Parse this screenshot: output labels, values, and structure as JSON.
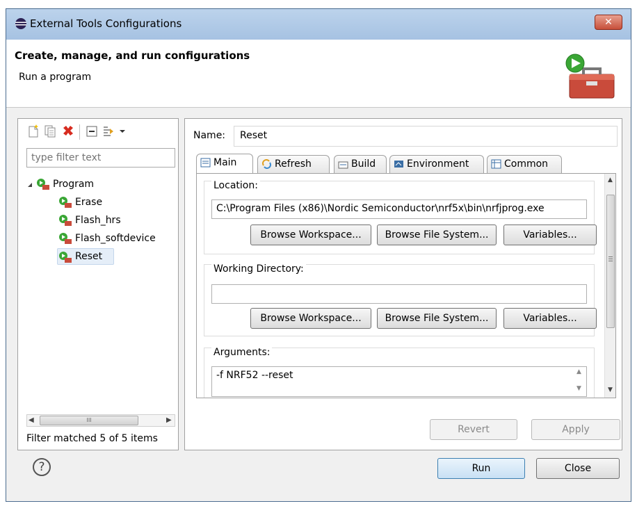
{
  "window": {
    "title": "External Tools Configurations",
    "close_label": "✕"
  },
  "header": {
    "title": "Create, manage, and run configurations",
    "subtitle": "Run a program"
  },
  "left": {
    "filter_placeholder": "type filter text",
    "tree": {
      "root": "Program",
      "children": [
        "Erase",
        "Flash_hrs",
        "Flash_softdevice",
        "Reset"
      ],
      "selected": "Reset"
    },
    "status": "Filter matched 5 of 5 items",
    "scroll_grip": "III"
  },
  "right": {
    "name_label": "Name:",
    "name_value": "Reset",
    "tabs": [
      "Main",
      "Refresh",
      "Build",
      "Environment",
      "Common"
    ],
    "active_tab": "Main",
    "location": {
      "label": "Location:",
      "value": "C:\\Program Files (x86)\\Nordic Semiconductor\\nrf5x\\bin\\nrfjprog.exe"
    },
    "working_directory": {
      "label": "Working Directory:",
      "value": ""
    },
    "arguments": {
      "label": "Arguments:",
      "value": "-f NRF52 --reset"
    },
    "buttons": {
      "browse_workspace": "Browse Workspace...",
      "browse_file_system": "Browse File System...",
      "variables": "Variables...",
      "revert": "Revert",
      "apply": "Apply"
    }
  },
  "footer": {
    "run": "Run",
    "close": "Close",
    "help": "?"
  },
  "colors": {
    "title_bar": "#a6c2e2",
    "close_button": "#c74f3a",
    "run_button_border": "#3c7fb1",
    "tree_selection": "#e5eef8"
  }
}
